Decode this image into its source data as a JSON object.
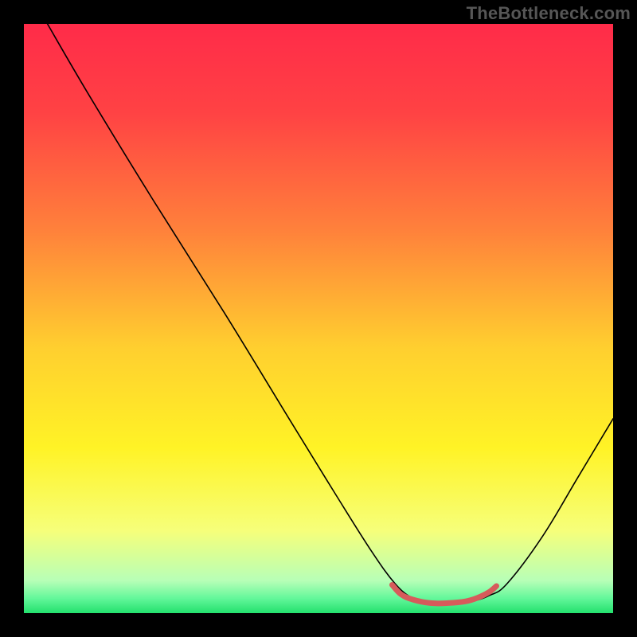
{
  "watermark": "TheBottleneck.com",
  "chart_data": {
    "type": "line",
    "title": "",
    "xlabel": "",
    "ylabel": "",
    "xlim": [
      0,
      100
    ],
    "ylim": [
      0,
      100
    ],
    "background_gradient": {
      "stops": [
        {
          "pos": 0.0,
          "color": "#ff2b49"
        },
        {
          "pos": 0.15,
          "color": "#ff4244"
        },
        {
          "pos": 0.35,
          "color": "#ff813b"
        },
        {
          "pos": 0.55,
          "color": "#ffcf2f"
        },
        {
          "pos": 0.72,
          "color": "#fff326"
        },
        {
          "pos": 0.86,
          "color": "#f6ff7a"
        },
        {
          "pos": 0.945,
          "color": "#b7ffb7"
        },
        {
          "pos": 0.975,
          "color": "#63f79a"
        },
        {
          "pos": 1.0,
          "color": "#23e06d"
        }
      ]
    },
    "series": [
      {
        "name": "bottleneck-curve",
        "color": "#000000",
        "width": 1.6,
        "points": [
          {
            "x": 4.0,
            "y": 100.0
          },
          {
            "x": 11.0,
            "y": 88.0
          },
          {
            "x": 22.0,
            "y": 70.0
          },
          {
            "x": 34.0,
            "y": 51.0
          },
          {
            "x": 45.0,
            "y": 33.0
          },
          {
            "x": 53.0,
            "y": 20.0
          },
          {
            "x": 59.0,
            "y": 10.5
          },
          {
            "x": 63.0,
            "y": 5.0
          },
          {
            "x": 66.0,
            "y": 2.5
          },
          {
            "x": 69.0,
            "y": 1.6
          },
          {
            "x": 72.0,
            "y": 1.6
          },
          {
            "x": 76.0,
            "y": 2.0
          },
          {
            "x": 79.0,
            "y": 3.0
          },
          {
            "x": 82.0,
            "y": 5.0
          },
          {
            "x": 88.0,
            "y": 13.0
          },
          {
            "x": 94.0,
            "y": 23.0
          },
          {
            "x": 100.0,
            "y": 33.0
          }
        ]
      },
      {
        "name": "optimal-range-marker",
        "color": "#d65b5b",
        "width": 7,
        "points": [
          {
            "x": 62.5,
            "y": 4.8
          },
          {
            "x": 64.0,
            "y": 3.2
          },
          {
            "x": 66.0,
            "y": 2.3
          },
          {
            "x": 69.0,
            "y": 1.7
          },
          {
            "x": 72.0,
            "y": 1.7
          },
          {
            "x": 75.0,
            "y": 2.0
          },
          {
            "x": 77.0,
            "y": 2.6
          },
          {
            "x": 79.0,
            "y": 3.6
          },
          {
            "x": 80.2,
            "y": 4.6
          }
        ]
      }
    ]
  }
}
